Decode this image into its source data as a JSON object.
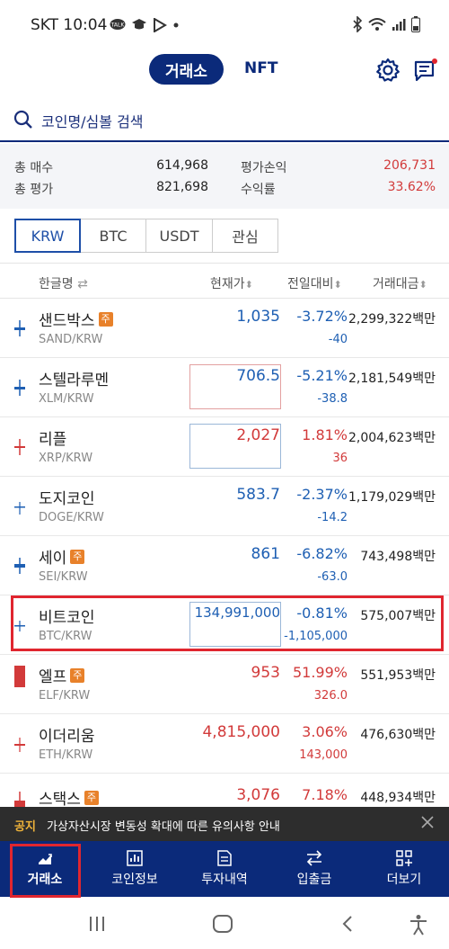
{
  "status_bar": {
    "carrier_time": "SKT 10:04",
    "left_icons": [
      "talk-icon",
      "education-icon",
      "play-icon",
      "dot-icon"
    ],
    "right_icons": [
      "bluetooth-icon",
      "wifi-icon",
      "signal-icon",
      "battery-icon"
    ]
  },
  "top_nav": {
    "tab_exchange": "거래소",
    "tab_nft": "NFT"
  },
  "search": {
    "placeholder": "코인명/심볼 검색"
  },
  "summary": {
    "total_buy_label": "총 매수",
    "total_buy_value": "614,968",
    "total_eval_label": "총 평가",
    "total_eval_value": "821,698",
    "pnl_label": "평가손익",
    "pnl_value": "206,731",
    "return_label": "수익률",
    "return_value": "33.62%"
  },
  "segments": [
    "KRW",
    "BTC",
    "USDT",
    "관심"
  ],
  "table": {
    "headers": {
      "name": "한글명",
      "price": "현재가",
      "change": "전일대비",
      "volume": "거래대금"
    },
    "rows": [
      {
        "name": "샌드박스",
        "badge": "주",
        "symbol": "SAND/KRW",
        "price": "1,035",
        "rate": "-3.72%",
        "diff": "-40",
        "volume": "2,299,322백만",
        "dir": "down"
      },
      {
        "name": "스텔라루멘",
        "badge": "",
        "symbol": "XLM/KRW",
        "price": "706.5",
        "rate": "-5.21%",
        "diff": "-38.8",
        "volume": "2,181,549백만",
        "dir": "down"
      },
      {
        "name": "리플",
        "badge": "",
        "symbol": "XRP/KRW",
        "price": "2,027",
        "rate": "1.81%",
        "diff": "36",
        "volume": "2,004,623백만",
        "dir": "up"
      },
      {
        "name": "도지코인",
        "badge": "",
        "symbol": "DOGE/KRW",
        "price": "583.7",
        "rate": "-2.37%",
        "diff": "-14.2",
        "volume": "1,179,029백만",
        "dir": "down"
      },
      {
        "name": "세이",
        "badge": "주",
        "symbol": "SEI/KRW",
        "price": "861",
        "rate": "-6.82%",
        "diff": "-63.0",
        "volume": "743,498백만",
        "dir": "down"
      },
      {
        "name": "비트코인",
        "badge": "",
        "symbol": "BTC/KRW",
        "price": "134,991,000",
        "rate": "-0.81%",
        "diff": "-1,105,000",
        "volume": "575,007백만",
        "dir": "down"
      },
      {
        "name": "엘프",
        "badge": "주",
        "symbol": "ELF/KRW",
        "price": "953",
        "rate": "51.99%",
        "diff": "326.0",
        "volume": "551,953백만",
        "dir": "up"
      },
      {
        "name": "이더리움",
        "badge": "",
        "symbol": "ETH/KRW",
        "price": "4,815,000",
        "rate": "3.06%",
        "diff": "143,000",
        "volume": "476,630백만",
        "dir": "up"
      },
      {
        "name": "스택스",
        "badge": "주",
        "symbol": "",
        "price": "3,076",
        "rate": "7.18%",
        "diff": "",
        "volume": "448,934백만",
        "dir": "up"
      }
    ]
  },
  "notice": {
    "tag": "공지",
    "text": "가상자산시장 변동성 확대에 따른 유의사항 안내"
  },
  "bottom_nav": {
    "exchange": "거래소",
    "coin_info": "코인정보",
    "history": "투자내역",
    "transfer": "입출금",
    "more": "더보기"
  },
  "colors": {
    "brand": "#0b2a7a",
    "up": "#d23a3a",
    "down": "#1e5fb3",
    "highlight": "#e0262f",
    "badge": "#e8812a"
  }
}
